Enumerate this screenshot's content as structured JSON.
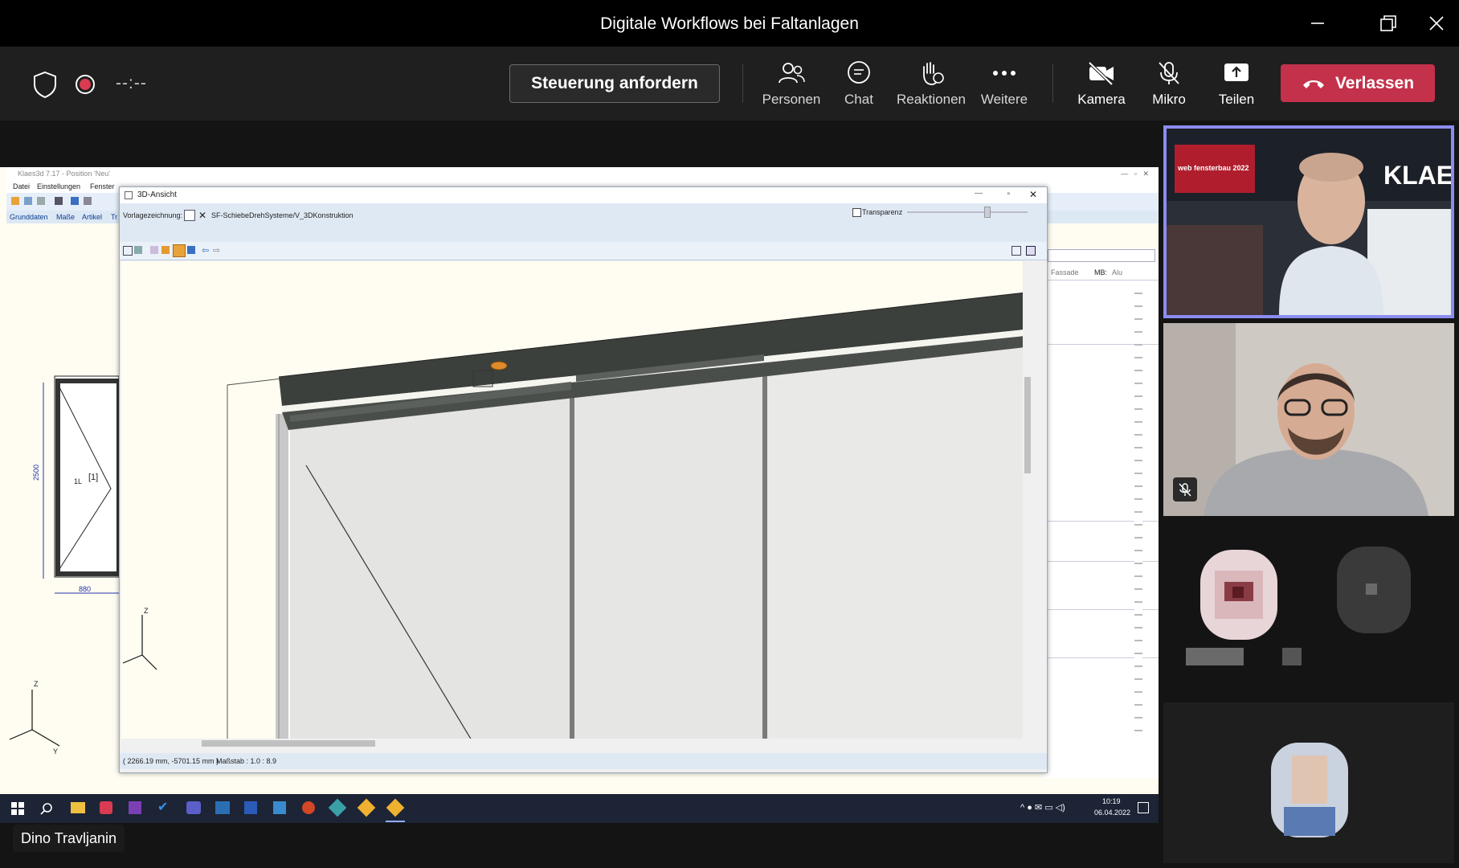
{
  "window": {
    "title": "Digitale Workflows bei Faltanlagen"
  },
  "toolbar": {
    "timer": "--:--",
    "request_control": "Steuerung anfordern",
    "people": "Personen",
    "chat": "Chat",
    "reactions": "Reaktionen",
    "more": "Weitere",
    "camera": "Kamera",
    "mic": "Mikro",
    "share": "Teilen",
    "leave": "Verlassen"
  },
  "shared": {
    "app_title": "Klaes3d 7.17 - Position 'Neu'",
    "menu": [
      "Datei",
      "Einstellungen",
      "Fenster"
    ],
    "tabs": [
      "Grunddaten",
      "Maße",
      "Artikel",
      "Tr"
    ],
    "drawing": {
      "label": "1L",
      "bracket": "[1]",
      "height": "2500",
      "width": "880",
      "axis_z": "Z",
      "axis_y": "Y"
    },
    "right_fields": {
      "fassade": "Fassade",
      "mb": "MB:",
      "alu": "Alu"
    },
    "view3d": {
      "title": "3D-Ansicht",
      "template_label": "Vorlagezeichnung:",
      "template_value": "SF-SchiebeDrehSysteme/V_3DKonstruktion",
      "transparency": "Transparenz",
      "axis_z": "Z",
      "coords": "( 2266.19 mm, -5701.15 mm )",
      "scale": "Maßstab : 1.0 : 8.9"
    },
    "taskbar": {
      "time": "10:19",
      "date": "06.04.2022"
    }
  },
  "participants": {
    "speaker_name": "Dino Travljanin",
    "booth_text": "KLAE",
    "banner_text": "web fensterbau 2022"
  },
  "colors": {
    "leave": "#c4314b",
    "active_border": "#8b8cf0",
    "toolbar_bg": "#1f1f1f"
  }
}
